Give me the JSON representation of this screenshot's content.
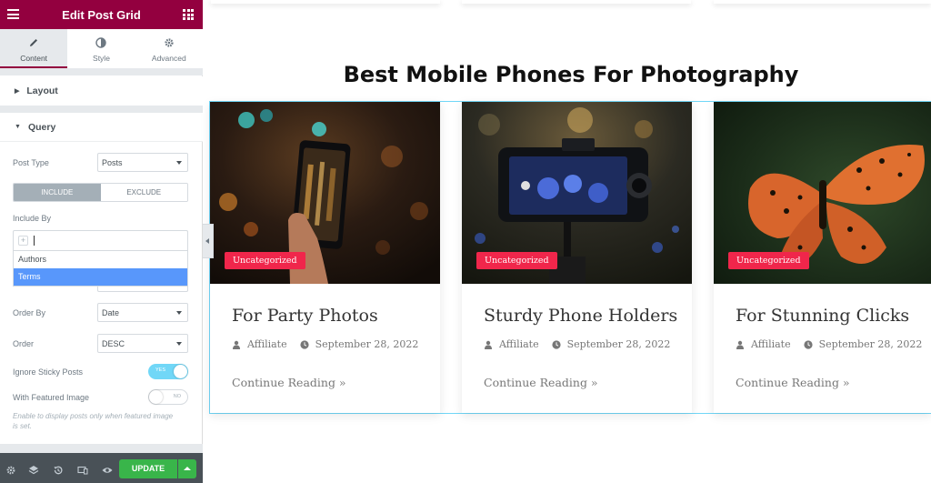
{
  "editor": {
    "title": "Edit Post Grid",
    "tabs": [
      {
        "label": "Content",
        "icon": "pencil-icon"
      },
      {
        "label": "Style",
        "icon": "half-circle-icon"
      },
      {
        "label": "Advanced",
        "icon": "gear-icon"
      }
    ],
    "sections": {
      "layout": "Layout",
      "query": "Query"
    },
    "post_type": {
      "label": "Post Type",
      "value": "Posts"
    },
    "include_exclude": {
      "include": "INCLUDE",
      "exclude": "EXCLUDE",
      "selected": "INCLUDE"
    },
    "include_by": {
      "label": "Include By",
      "options": [
        "Authors",
        "Terms"
      ],
      "highlighted": "Terms"
    },
    "order_by": {
      "label": "Order By",
      "value": "Date"
    },
    "order": {
      "label": "Order",
      "value": "DESC"
    },
    "ignore_sticky": {
      "label": "Ignore Sticky Posts",
      "state": "YES"
    },
    "featured_image": {
      "label": "With Featured Image",
      "state": "NO",
      "description": "Enable to display posts only when featured image is set."
    },
    "footer": {
      "update_label": "UPDATE",
      "icons": [
        "settings-icon",
        "layers-icon",
        "history-icon",
        "responsive-icon",
        "preview-icon"
      ]
    }
  },
  "page": {
    "heading": "Best Mobile Phones For Photography",
    "posts": [
      {
        "category": "Uncategorized",
        "title": "For Party Photos",
        "author": "Affiliate",
        "date": "September 28, 2022",
        "read_more": "Continue Reading »"
      },
      {
        "category": "Uncategorized",
        "title": "Sturdy Phone Holders",
        "author": "Affiliate",
        "date": "September 28, 2022",
        "read_more": "Continue Reading »"
      },
      {
        "category": "Uncategorized",
        "title": "For Stunning Clicks",
        "author": "Affiliate",
        "date": "September 28, 2022",
        "read_more": "Continue Reading »"
      }
    ]
  },
  "colors": {
    "header": "#93003f",
    "badge": "#f0264b",
    "update": "#39b54a",
    "selection": "#71d7f7"
  }
}
